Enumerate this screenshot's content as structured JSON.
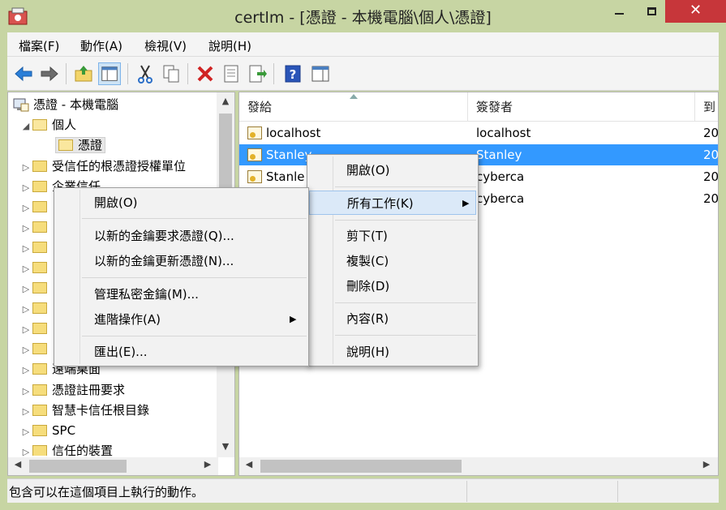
{
  "window": {
    "title": "certlm - [憑證 - 本機電腦\\個人\\憑證]",
    "close_glyph": "✕"
  },
  "menubar": [
    {
      "label": "檔案(F)"
    },
    {
      "label": "動作(A)"
    },
    {
      "label": "檢視(V)"
    },
    {
      "label": "說明(H)"
    }
  ],
  "toolbar": {
    "icons": [
      "back-icon",
      "forward-icon",
      "up-folder-icon",
      "show-hide-tree-icon",
      "cut-icon",
      "copy-icon",
      "delete-icon",
      "properties-icon",
      "export-list-icon",
      "help-icon",
      "show-action-pane-icon"
    ]
  },
  "tree": {
    "root": "憑證 - 本機電腦",
    "personal": "個人",
    "certificates": "憑證",
    "trusted_root": "受信任的根憑證授權單位",
    "enterprise_trust": "企業信任",
    "remote_desktop": "遠端桌面",
    "enrollment_requests": "憑證註冊要求",
    "smart_card_roots": "智慧卡信任根目錄",
    "spc": "SPC",
    "trusted_devices": "信任的裝置"
  },
  "list": {
    "columns": [
      "發給",
      "簽發者",
      "到"
    ],
    "rows": [
      {
        "issued_to": "localhost",
        "issued_by": "localhost",
        "expiry": "20"
      },
      {
        "issued_to": "Stanley",
        "issued_by": "Stanley",
        "expiry": "20"
      },
      {
        "issued_to": "Stanle",
        "issued_by": "cyberca",
        "expiry": "20"
      },
      {
        "issued_to": "",
        "issued_by": "cyberca",
        "expiry": "20"
      }
    ]
  },
  "context_menu_main": {
    "open": "開啟(O)",
    "all_tasks": "所有工作(K)",
    "cut": "剪下(T)",
    "copy": "複製(C)",
    "delete": "刪除(D)",
    "properties": "內容(R)",
    "help": "說明(H)"
  },
  "context_menu_tasks": {
    "open": "開啟(O)",
    "request_new_key": "以新的金鑰要求憑證(Q)...",
    "renew_new_key": "以新的金鑰更新憑證(N)...",
    "manage_private_keys": "管理私密金鑰(M)...",
    "advanced": "進階操作(A)",
    "export": "匯出(E)..."
  },
  "status": {
    "text": "包含可以在這個項目上執行的動作。"
  }
}
